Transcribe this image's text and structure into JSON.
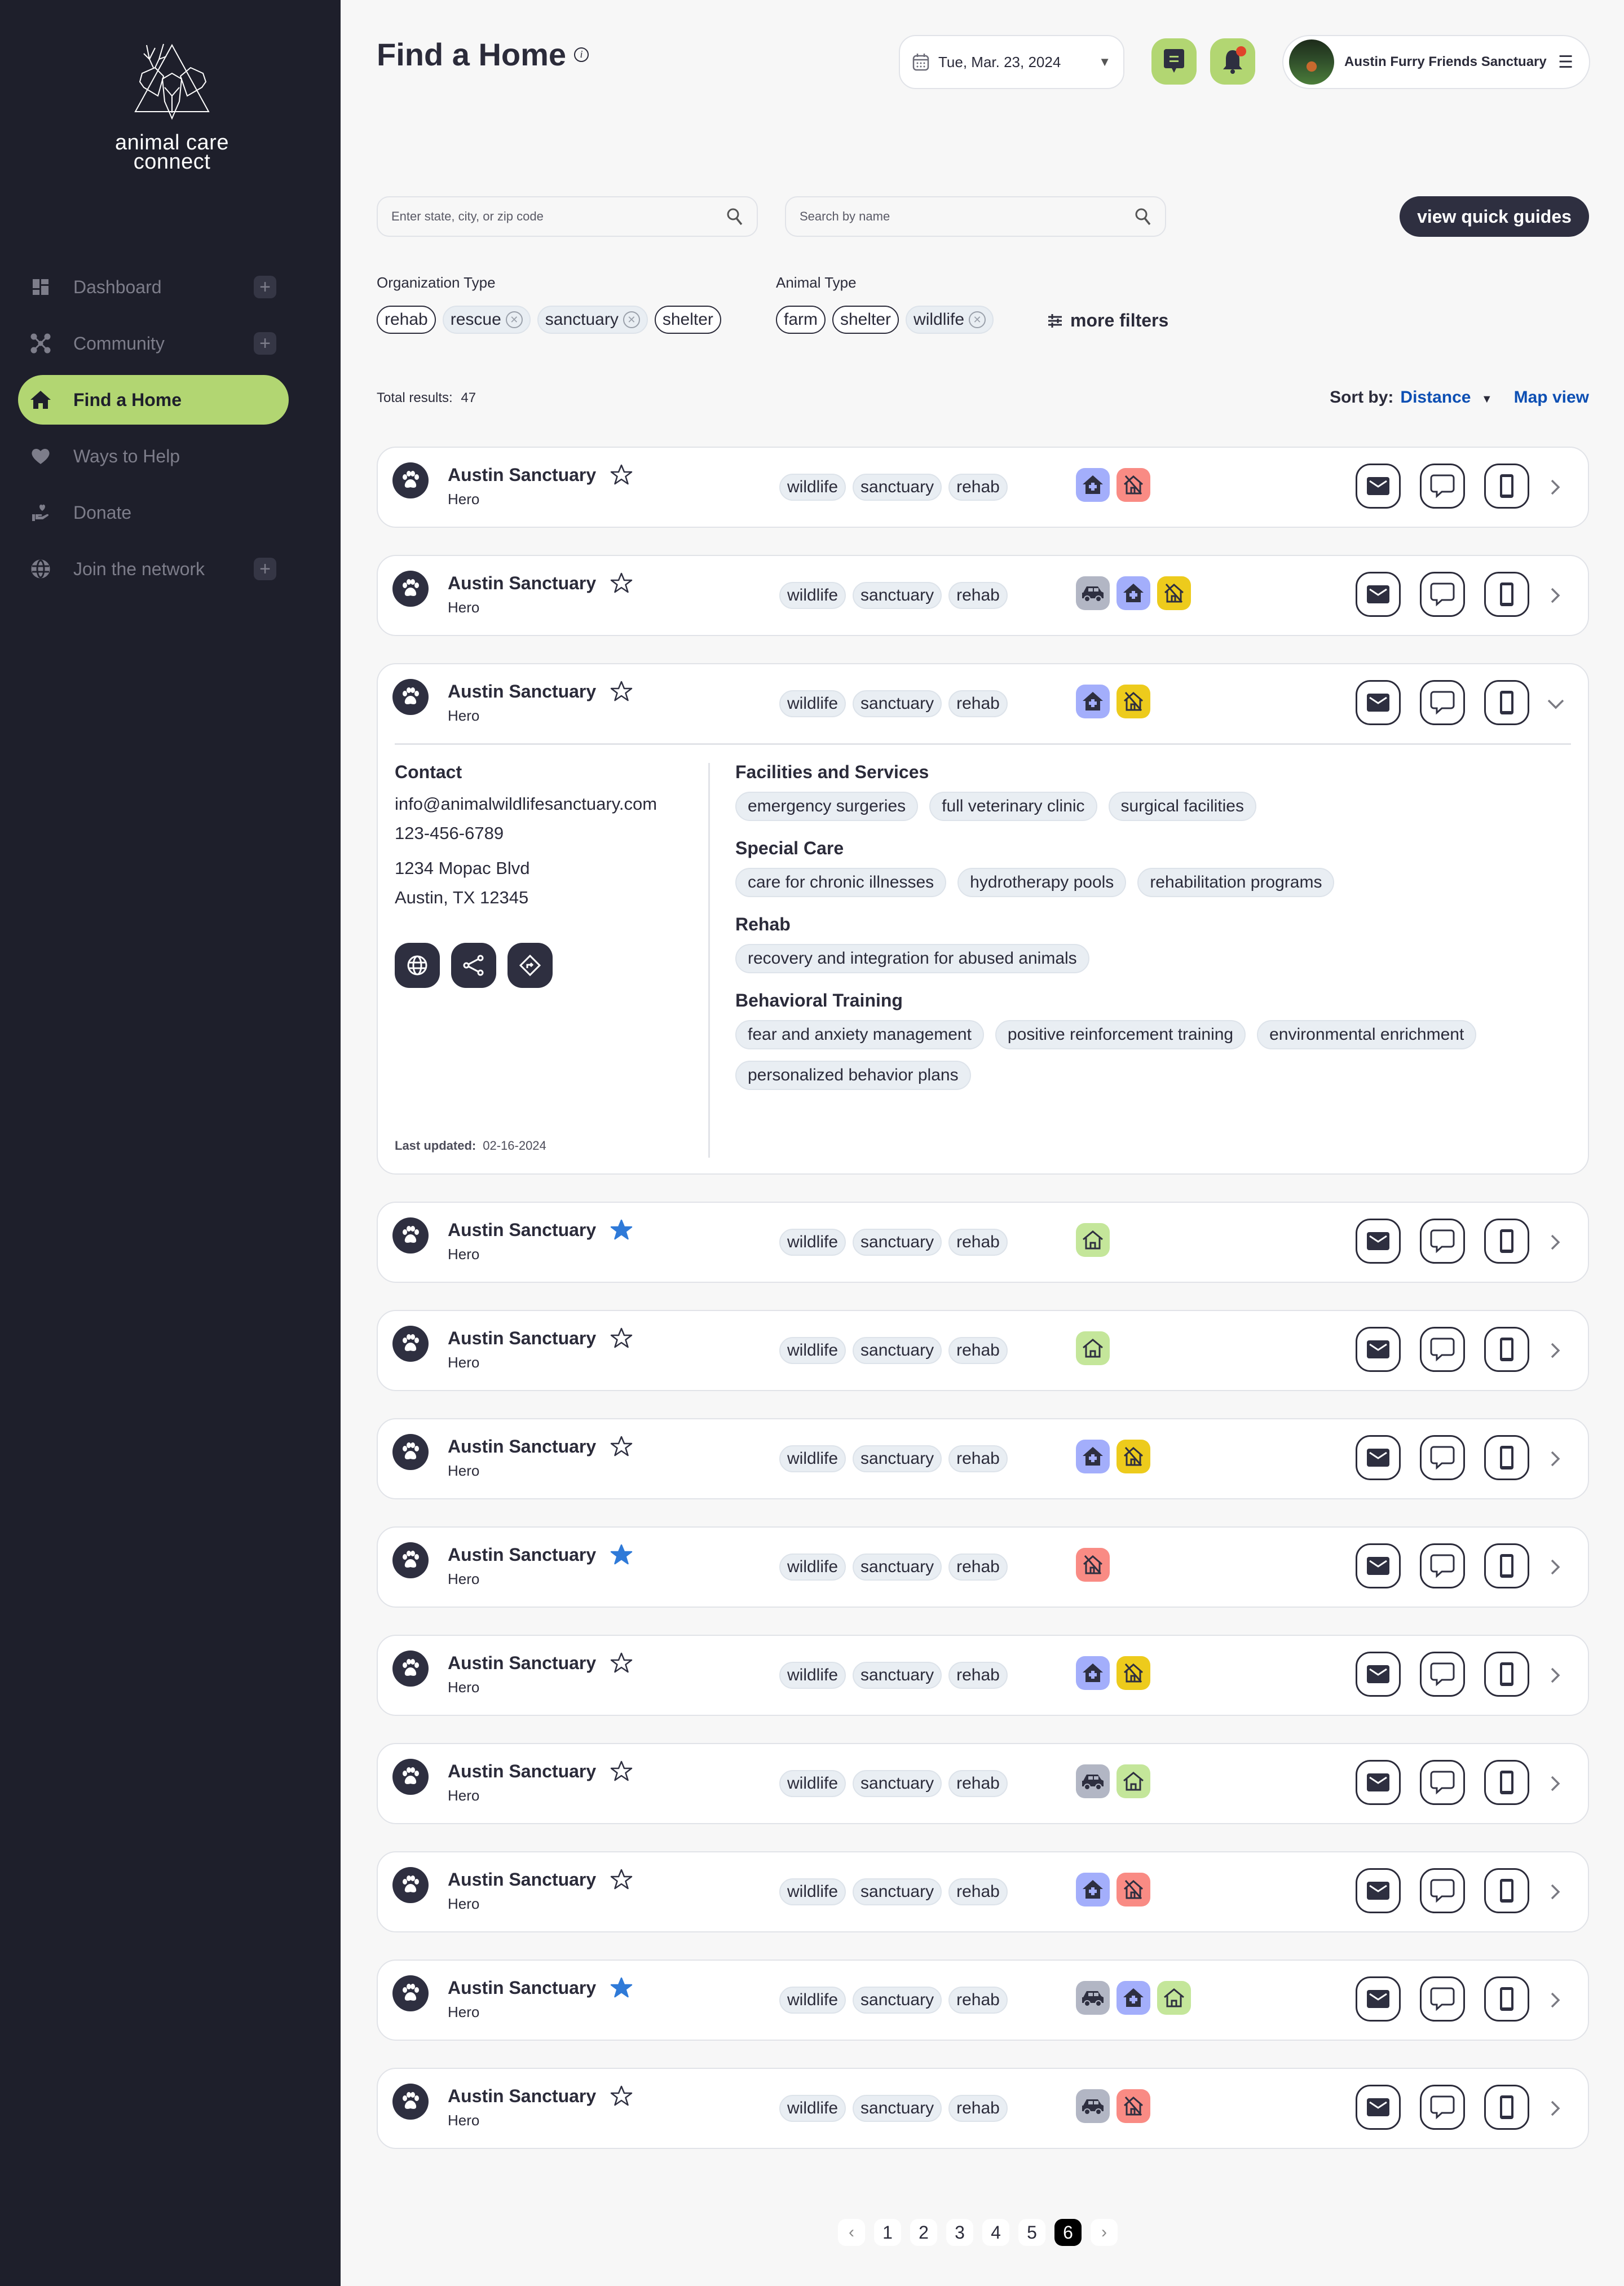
{
  "brand": {
    "name_line1": "animal care",
    "name_line2": "connect"
  },
  "sidebar": {
    "items": [
      {
        "label": "Dashboard",
        "icon": "dashboard-icon",
        "has_plus": true,
        "active": false
      },
      {
        "label": "Community",
        "icon": "community-icon",
        "has_plus": true,
        "active": false
      },
      {
        "label": "Find a Home",
        "icon": "home-icon",
        "has_plus": false,
        "active": true
      },
      {
        "label": "Ways to Help",
        "icon": "heart-icon",
        "has_plus": false,
        "active": false
      },
      {
        "label": "Donate",
        "icon": "donate-hand-icon",
        "has_plus": false,
        "active": false
      },
      {
        "label": "Join the network",
        "icon": "globe-icon",
        "has_plus": true,
        "active": false
      }
    ]
  },
  "header": {
    "title": "Find a Home",
    "date": "Tue, Mar. 23, 2024",
    "profile_name": "Austin Furry Friends Sanctuary",
    "has_notification": true
  },
  "search": {
    "location_placeholder": "Enter state, city, or zip code",
    "location_value": "",
    "name_placeholder": "Search by name",
    "name_value": "",
    "guides_label": "view quick guides"
  },
  "filters": {
    "org_type_label": "Organization Type",
    "org_types": [
      {
        "label": "rehab",
        "selected": false
      },
      {
        "label": "rescue",
        "selected": true
      },
      {
        "label": "sanctuary",
        "selected": true
      },
      {
        "label": "shelter",
        "selected": false
      }
    ],
    "animal_type_label": "Animal Type",
    "animal_types": [
      {
        "label": "farm",
        "selected": false
      },
      {
        "label": "shelter",
        "selected": false
      },
      {
        "label": "wildlife",
        "selected": true
      }
    ],
    "more_filters_label": "more filters"
  },
  "results": {
    "total_label": "Total results:",
    "total": "47",
    "sort_label": "Sort by:",
    "sort_value": "Distance",
    "map_view_label": "Map view"
  },
  "colors": {
    "accent_green": "#b2d672",
    "sidebar_bg": "#1e1f2b",
    "dark": "#2e2f40",
    "link_blue": "#0d4fb3",
    "star_blue": "#2f7ad8",
    "feature_transport": "#b2b6c4",
    "feature_medical": "#a3aefb",
    "feature_no_home_red": "#f98b84",
    "feature_no_home_yellow": "#edcb1c",
    "feature_home": "#c4e69a"
  },
  "listings": [
    {
      "name": "Austin Sanctuary",
      "sub": "Hero",
      "favorite": false,
      "tags": [
        "wildlife",
        "sanctuary",
        "rehab"
      ],
      "features": [
        "medical",
        "no-home-red"
      ],
      "expanded": false
    },
    {
      "name": "Austin Sanctuary",
      "sub": "Hero",
      "favorite": false,
      "tags": [
        "wildlife",
        "sanctuary",
        "rehab"
      ],
      "features": [
        "transport",
        "medical",
        "no-home-yellow"
      ],
      "expanded": false
    },
    {
      "name": "Austin Sanctuary",
      "sub": "Hero",
      "favorite": false,
      "tags": [
        "wildlife",
        "sanctuary",
        "rehab"
      ],
      "features": [
        "medical",
        "no-home-yellow"
      ],
      "expanded": true
    },
    {
      "name": "Austin Sanctuary",
      "sub": "Hero",
      "favorite": true,
      "tags": [
        "wildlife",
        "sanctuary",
        "rehab"
      ],
      "features": [
        "home"
      ],
      "expanded": false
    },
    {
      "name": "Austin Sanctuary",
      "sub": "Hero",
      "favorite": false,
      "tags": [
        "wildlife",
        "sanctuary",
        "rehab"
      ],
      "features": [
        "home"
      ],
      "expanded": false
    },
    {
      "name": "Austin Sanctuary",
      "sub": "Hero",
      "favorite": false,
      "tags": [
        "wildlife",
        "sanctuary",
        "rehab"
      ],
      "features": [
        "medical",
        "no-home-yellow"
      ],
      "expanded": false
    },
    {
      "name": "Austin Sanctuary",
      "sub": "Hero",
      "favorite": true,
      "tags": [
        "wildlife",
        "sanctuary",
        "rehab"
      ],
      "features": [
        "no-home-red"
      ],
      "expanded": false
    },
    {
      "name": "Austin Sanctuary",
      "sub": "Hero",
      "favorite": false,
      "tags": [
        "wildlife",
        "sanctuary",
        "rehab"
      ],
      "features": [
        "medical",
        "no-home-yellow"
      ],
      "expanded": false
    },
    {
      "name": "Austin Sanctuary",
      "sub": "Hero",
      "favorite": false,
      "tags": [
        "wildlife",
        "sanctuary",
        "rehab"
      ],
      "features": [
        "transport",
        "home"
      ],
      "expanded": false
    },
    {
      "name": "Austin Sanctuary",
      "sub": "Hero",
      "favorite": false,
      "tags": [
        "wildlife",
        "sanctuary",
        "rehab"
      ],
      "features": [
        "medical",
        "no-home-red"
      ],
      "expanded": false
    },
    {
      "name": "Austin Sanctuary",
      "sub": "Hero",
      "favorite": true,
      "tags": [
        "wildlife",
        "sanctuary",
        "rehab"
      ],
      "features": [
        "transport",
        "medical",
        "home"
      ],
      "expanded": false
    },
    {
      "name": "Austin Sanctuary",
      "sub": "Hero",
      "favorite": false,
      "tags": [
        "wildlife",
        "sanctuary",
        "rehab"
      ],
      "features": [
        "transport",
        "no-home-red"
      ],
      "expanded": false
    }
  ],
  "expanded_detail": {
    "contact_title": "Contact",
    "email": "info@animalwildlifesanctuary.com",
    "phone": "123-456-6789",
    "address_line1": "1234 Mopac Blvd",
    "address_line2": "Austin, TX 12345",
    "last_updated_label": "Last updated:",
    "last_updated": "02-16-2024",
    "groups": [
      {
        "title": "Facilities and Services",
        "items": [
          "emergency surgeries",
          "full veterinary clinic",
          "surgical facilities"
        ]
      },
      {
        "title": "Special Care",
        "items": [
          "care for chronic illnesses",
          "hydrotherapy pools",
          "rehabilitation programs"
        ]
      },
      {
        "title": "Rehab",
        "items": [
          "recovery and integration for abused animals"
        ]
      },
      {
        "title": "Behavioral Training",
        "items": [
          "fear and anxiety management",
          "positive reinforcement training",
          "environmental enrichment",
          "personalized behavior plans"
        ]
      }
    ]
  },
  "pagination": {
    "pages": [
      "1",
      "2",
      "3",
      "4",
      "5",
      "6"
    ],
    "current": "6"
  }
}
